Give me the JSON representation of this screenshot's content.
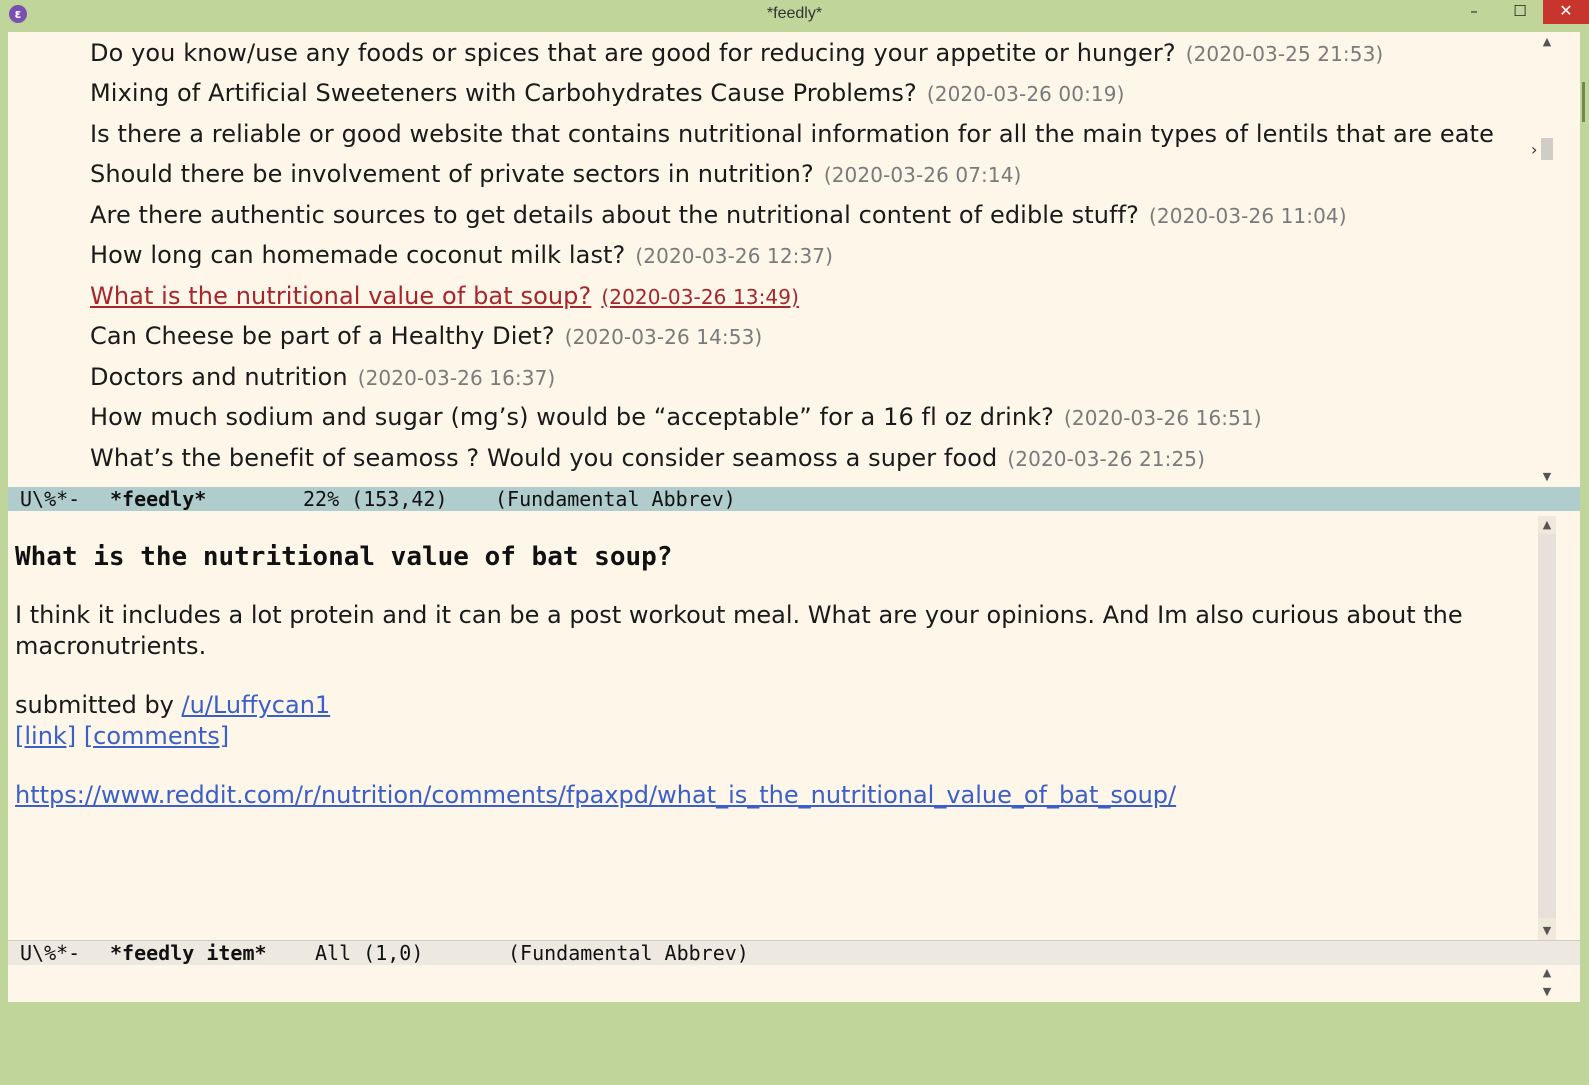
{
  "window": {
    "title": "*feedly*",
    "app_icon": "emacs-icon",
    "controls": {
      "minimize": "–",
      "maximize": "☐",
      "close": "✕"
    }
  },
  "feed_list": {
    "items": [
      {
        "title": "Do you know/use any foods or spices that are good for reducing your appetite or hunger?",
        "date": "(2020-03-25 21:53)"
      },
      {
        "title": "Mixing of Artificial Sweeteners with Carbohydrates Cause Problems?",
        "date": "(2020-03-26 00:19)"
      },
      {
        "title": "Is there a reliable or good website that contains nutritional information for all the main types of lentils that are eate",
        "date": ""
      },
      {
        "title": "Should there be involvement of private sectors in nutrition?",
        "date": "(2020-03-26 07:14)"
      },
      {
        "title": "Are there authentic sources to get details about the nutritional content of edible stuff?",
        "date": "(2020-03-26 11:04)"
      },
      {
        "title": "How long can homemade coconut milk last?",
        "date": "(2020-03-26 12:37)"
      },
      {
        "title": "What is the nutritional value of bat soup?",
        "date": "(2020-03-26 13:49)"
      },
      {
        "title": "Can Cheese be part of a Healthy Diet?",
        "date": "(2020-03-26 14:53)"
      },
      {
        "title": "Doctors and nutrition",
        "date": "(2020-03-26 16:37)"
      },
      {
        "title": "How much sodium and sugar (mg’s) would be “acceptable” for a 16 fl oz drink?",
        "date": "(2020-03-26 16:51)"
      },
      {
        "title": "What’s the benefit of seamoss ? Would you consider seamoss a super food",
        "date": "(2020-03-26 21:25)"
      }
    ],
    "active_index": 6,
    "truncation_mark": "›"
  },
  "modeline_top": {
    "state": "U\\%*-",
    "buffer": "*feedly*",
    "position": "22% (153,42)",
    "modes": "(Fundamental Abbrev)"
  },
  "item": {
    "heading": "What is the nutritional value of bat soup?",
    "body": "I think it includes a lot protein and it can be a post workout meal. What are your opinions. And Im also curious about the macronutrients.",
    "submitted_prefix": "submitted by ",
    "author": "/u/Luffycan1",
    "link_label": "[link]",
    "comments_label": "[comments]",
    "url": "https://www.reddit.com/r/nutrition/comments/fpaxpd/what_is_the_nutritional_value_of_bat_soup/"
  },
  "modeline_bottom": {
    "state": "U\\%*-",
    "buffer": "*feedly item*",
    "position": "All (1,0)",
    "modes": "(Fundamental Abbrev)"
  },
  "scrollbar": {
    "up_arrow": "▲",
    "down_arrow": "▼"
  },
  "scroll_position_top": 0.22
}
